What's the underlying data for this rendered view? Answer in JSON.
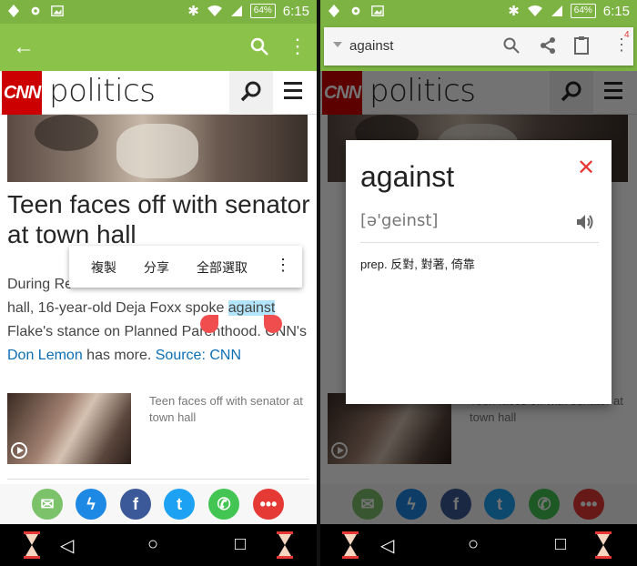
{
  "status": {
    "battery": "64%",
    "time": "6:15"
  },
  "cnn": {
    "logo": "CNN",
    "section": "politics"
  },
  "article": {
    "headline": "Teen faces off with senator at town hall",
    "body_pre": "During Re",
    "body_mid1": "hall, 16-year-old Deja Foxx spoke ",
    "body_highlight": "against",
    "body_line3": "Flake's stance on Planned Parenthood. CNN's",
    "body_link": "Don Lemon",
    "body_after_link": " has more.  ",
    "source": "Source: CNN"
  },
  "context_menu": {
    "copy": "複製",
    "share": "分享",
    "select_all": "全部選取"
  },
  "related": {
    "title": "Teen faces off with senator at town hall"
  },
  "dictionary": {
    "query": "against",
    "badge": "4",
    "word": "against",
    "phonetic": "[ə'geinst]",
    "definition": "prep. 反對, 對著, 倚靠"
  },
  "share_icons": [
    "email-icon",
    "messenger-icon",
    "facebook-icon",
    "twitter-icon",
    "whatsapp-icon",
    "more-icon"
  ],
  "colors": {
    "statusbar": "#7cb342",
    "appbar": "#8bc34a",
    "cnn_red": "#cc0000",
    "link": "#0c6fb3",
    "highlight": "#b3e5fc"
  }
}
